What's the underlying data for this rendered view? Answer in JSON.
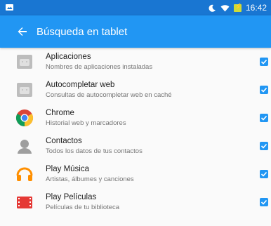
{
  "status": {
    "time": "16:42",
    "moon_icon": "moon-icon",
    "wifi_icon": "wifi-icon",
    "battery_icon": "battery-charging-icon"
  },
  "appbar": {
    "title": "Búsqueda en tablet",
    "back_icon": "arrow-back-icon"
  },
  "items": [
    {
      "label": "Aplicaciones",
      "description": "Nombres de aplicaciones instaladas",
      "checked": true,
      "icon": "generic-android-app-icon"
    },
    {
      "label": "Autocompletar web",
      "description": "Consultas de autocompletar web en caché",
      "checked": true,
      "icon": "generic-android-app-icon"
    },
    {
      "label": "Chrome",
      "description": "Historial web y marcadores",
      "checked": true,
      "icon": "chrome-icon"
    },
    {
      "label": "Contactos",
      "description": "Todos los datos de tus contactos",
      "checked": true,
      "icon": "contacts-icon"
    },
    {
      "label": "Play Música",
      "description": "Artistas, álbumes y canciones",
      "checked": true,
      "icon": "play-music-icon"
    },
    {
      "label": "Play Películas",
      "description": "Películas de tu biblioteca",
      "checked": true,
      "icon": "play-movies-icon"
    }
  ],
  "colors": {
    "status_bar": "#1976d2",
    "app_bar": "#2196f3",
    "accent": "#2196f3"
  }
}
